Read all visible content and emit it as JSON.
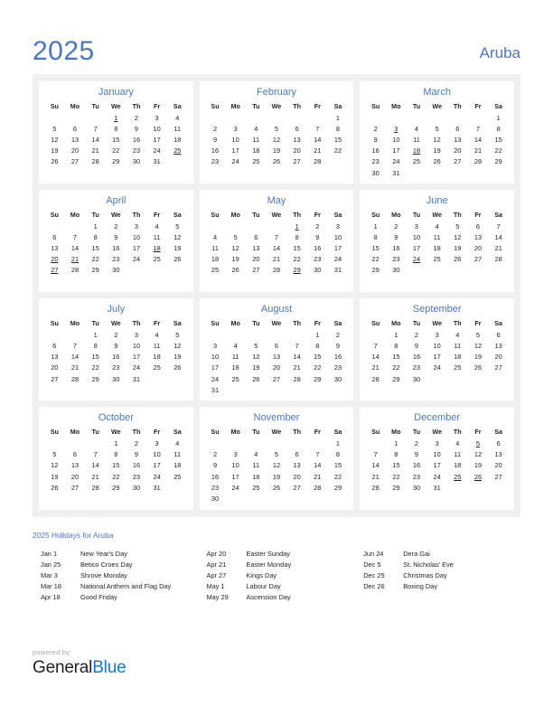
{
  "header": {
    "year": "2025",
    "country": "Aruba"
  },
  "weekday_headers": [
    "Su",
    "Mo",
    "Tu",
    "We",
    "Th",
    "Fr",
    "Sa"
  ],
  "months": [
    {
      "name": "January",
      "weeks": [
        [
          "",
          "",
          "",
          "1",
          "2",
          "3",
          "4"
        ],
        [
          "5",
          "6",
          "7",
          "8",
          "9",
          "10",
          "11"
        ],
        [
          "12",
          "13",
          "14",
          "15",
          "16",
          "17",
          "18"
        ],
        [
          "19",
          "20",
          "21",
          "22",
          "23",
          "24",
          "25"
        ],
        [
          "26",
          "27",
          "28",
          "29",
          "30",
          "31",
          ""
        ],
        [
          "",
          "",
          "",
          "",
          "",
          "",
          ""
        ]
      ],
      "holidays": [
        "1",
        "25"
      ]
    },
    {
      "name": "February",
      "weeks": [
        [
          "",
          "",
          "",
          "",
          "",
          "",
          "1"
        ],
        [
          "2",
          "3",
          "4",
          "5",
          "6",
          "7",
          "8"
        ],
        [
          "9",
          "10",
          "11",
          "12",
          "13",
          "14",
          "15"
        ],
        [
          "16",
          "17",
          "18",
          "19",
          "20",
          "21",
          "22"
        ],
        [
          "23",
          "24",
          "25",
          "26",
          "27",
          "28",
          ""
        ],
        [
          "",
          "",
          "",
          "",
          "",
          "",
          ""
        ]
      ],
      "holidays": []
    },
    {
      "name": "March",
      "weeks": [
        [
          "",
          "",
          "",
          "",
          "",
          "",
          "1"
        ],
        [
          "2",
          "3",
          "4",
          "5",
          "6",
          "7",
          "8"
        ],
        [
          "9",
          "10",
          "11",
          "12",
          "13",
          "14",
          "15"
        ],
        [
          "16",
          "17",
          "18",
          "19",
          "20",
          "21",
          "22"
        ],
        [
          "23",
          "24",
          "25",
          "26",
          "27",
          "28",
          "29"
        ],
        [
          "30",
          "31",
          "",
          "",
          "",
          "",
          ""
        ]
      ],
      "holidays": [
        "3",
        "18"
      ]
    },
    {
      "name": "April",
      "weeks": [
        [
          "",
          "",
          "1",
          "2",
          "3",
          "4",
          "5"
        ],
        [
          "6",
          "7",
          "8",
          "9",
          "10",
          "11",
          "12"
        ],
        [
          "13",
          "14",
          "15",
          "16",
          "17",
          "18",
          "19"
        ],
        [
          "20",
          "21",
          "22",
          "23",
          "24",
          "25",
          "26"
        ],
        [
          "27",
          "28",
          "29",
          "30",
          "",
          "",
          ""
        ],
        [
          "",
          "",
          "",
          "",
          "",
          "",
          ""
        ]
      ],
      "holidays": [
        "18",
        "20",
        "21",
        "27"
      ]
    },
    {
      "name": "May",
      "weeks": [
        [
          "",
          "",
          "",
          "",
          "1",
          "2",
          "3"
        ],
        [
          "4",
          "5",
          "6",
          "7",
          "8",
          "9",
          "10"
        ],
        [
          "11",
          "12",
          "13",
          "14",
          "15",
          "16",
          "17"
        ],
        [
          "18",
          "19",
          "20",
          "21",
          "22",
          "23",
          "24"
        ],
        [
          "25",
          "26",
          "27",
          "28",
          "29",
          "30",
          "31"
        ],
        [
          "",
          "",
          "",
          "",
          "",
          "",
          ""
        ]
      ],
      "holidays": [
        "1",
        "29"
      ]
    },
    {
      "name": "June",
      "weeks": [
        [
          "1",
          "2",
          "3",
          "4",
          "5",
          "6",
          "7"
        ],
        [
          "8",
          "9",
          "10",
          "11",
          "12",
          "13",
          "14"
        ],
        [
          "15",
          "16",
          "17",
          "18",
          "19",
          "20",
          "21"
        ],
        [
          "22",
          "23",
          "24",
          "25",
          "26",
          "27",
          "28"
        ],
        [
          "29",
          "30",
          "",
          "",
          "",
          "",
          ""
        ],
        [
          "",
          "",
          "",
          "",
          "",
          "",
          ""
        ]
      ],
      "holidays": [
        "24"
      ]
    },
    {
      "name": "July",
      "weeks": [
        [
          "",
          "",
          "1",
          "2",
          "3",
          "4",
          "5"
        ],
        [
          "6",
          "7",
          "8",
          "9",
          "10",
          "11",
          "12"
        ],
        [
          "13",
          "14",
          "15",
          "16",
          "17",
          "18",
          "19"
        ],
        [
          "20",
          "21",
          "22",
          "23",
          "24",
          "25",
          "26"
        ],
        [
          "27",
          "28",
          "29",
          "30",
          "31",
          "",
          ""
        ],
        [
          "",
          "",
          "",
          "",
          "",
          "",
          ""
        ]
      ],
      "holidays": []
    },
    {
      "name": "August",
      "weeks": [
        [
          "",
          "",
          "",
          "",
          "",
          "1",
          "2"
        ],
        [
          "3",
          "4",
          "5",
          "6",
          "7",
          "8",
          "9"
        ],
        [
          "10",
          "11",
          "12",
          "13",
          "14",
          "15",
          "16"
        ],
        [
          "17",
          "18",
          "19",
          "20",
          "21",
          "22",
          "23"
        ],
        [
          "24",
          "25",
          "26",
          "27",
          "28",
          "29",
          "30"
        ],
        [
          "31",
          "",
          "",
          "",
          "",
          "",
          ""
        ]
      ],
      "holidays": []
    },
    {
      "name": "September",
      "weeks": [
        [
          "",
          "1",
          "2",
          "3",
          "4",
          "5",
          "6"
        ],
        [
          "7",
          "8",
          "9",
          "10",
          "11",
          "12",
          "13"
        ],
        [
          "14",
          "15",
          "16",
          "17",
          "18",
          "19",
          "20"
        ],
        [
          "21",
          "22",
          "23",
          "24",
          "25",
          "26",
          "27"
        ],
        [
          "28",
          "29",
          "30",
          "",
          "",
          "",
          ""
        ],
        [
          "",
          "",
          "",
          "",
          "",
          "",
          ""
        ]
      ],
      "holidays": []
    },
    {
      "name": "October",
      "weeks": [
        [
          "",
          "",
          "",
          "1",
          "2",
          "3",
          "4"
        ],
        [
          "5",
          "6",
          "7",
          "8",
          "9",
          "10",
          "11"
        ],
        [
          "12",
          "13",
          "14",
          "15",
          "16",
          "17",
          "18"
        ],
        [
          "19",
          "20",
          "21",
          "22",
          "23",
          "24",
          "25"
        ],
        [
          "26",
          "27",
          "28",
          "29",
          "30",
          "31",
          ""
        ],
        [
          "",
          "",
          "",
          "",
          "",
          "",
          ""
        ]
      ],
      "holidays": []
    },
    {
      "name": "November",
      "weeks": [
        [
          "",
          "",
          "",
          "",
          "",
          "",
          "1"
        ],
        [
          "2",
          "3",
          "4",
          "5",
          "6",
          "7",
          "8"
        ],
        [
          "9",
          "10",
          "11",
          "12",
          "13",
          "14",
          "15"
        ],
        [
          "16",
          "17",
          "18",
          "19",
          "20",
          "21",
          "22"
        ],
        [
          "23",
          "24",
          "25",
          "26",
          "27",
          "28",
          "29"
        ],
        [
          "30",
          "",
          "",
          "",
          "",
          "",
          ""
        ]
      ],
      "holidays": []
    },
    {
      "name": "December",
      "weeks": [
        [
          "",
          "1",
          "2",
          "3",
          "4",
          "5",
          "6"
        ],
        [
          "7",
          "8",
          "9",
          "10",
          "11",
          "12",
          "13"
        ],
        [
          "14",
          "15",
          "16",
          "17",
          "18",
          "19",
          "20"
        ],
        [
          "21",
          "22",
          "23",
          "24",
          "25",
          "26",
          "27"
        ],
        [
          "28",
          "29",
          "30",
          "31",
          "",
          "",
          ""
        ],
        [
          "",
          "",
          "",
          "",
          "",
          "",
          ""
        ]
      ],
      "holidays": [
        "5",
        "25",
        "26"
      ]
    }
  ],
  "legend": {
    "title": "2025 Holidays for Aruba",
    "columns": [
      [
        {
          "date": "Jan 1",
          "name": "New Year's Day"
        },
        {
          "date": "Jan 25",
          "name": "Betico Croes Day"
        },
        {
          "date": "Mar 3",
          "name": "Shrove Monday"
        },
        {
          "date": "Mar 18",
          "name": "National Anthem and Flag Day"
        },
        {
          "date": "Apr 18",
          "name": "Good Friday"
        }
      ],
      [
        {
          "date": "Apr 20",
          "name": "Easter Sunday"
        },
        {
          "date": "Apr 21",
          "name": "Easter Monday"
        },
        {
          "date": "Apr 27",
          "name": "Kings Day"
        },
        {
          "date": "May 1",
          "name": "Labour Day"
        },
        {
          "date": "May 29",
          "name": "Ascension Day"
        }
      ],
      [
        {
          "date": "Jun 24",
          "name": "Dera Gai"
        },
        {
          "date": "Dec 5",
          "name": "St. Nicholas' Eve"
        },
        {
          "date": "Dec 25",
          "name": "Christmas Day"
        },
        {
          "date": "Dec 26",
          "name": "Boxing Day"
        }
      ]
    ]
  },
  "footer": {
    "powered_by": "powered by",
    "brand_first": "General",
    "brand_second": "Blue"
  },
  "colors": {
    "accent_blue": "#4a77c4",
    "holiday_red": "#e8120b",
    "brand_blue": "#1878c8",
    "panel_gray": "#f0f0f0"
  }
}
